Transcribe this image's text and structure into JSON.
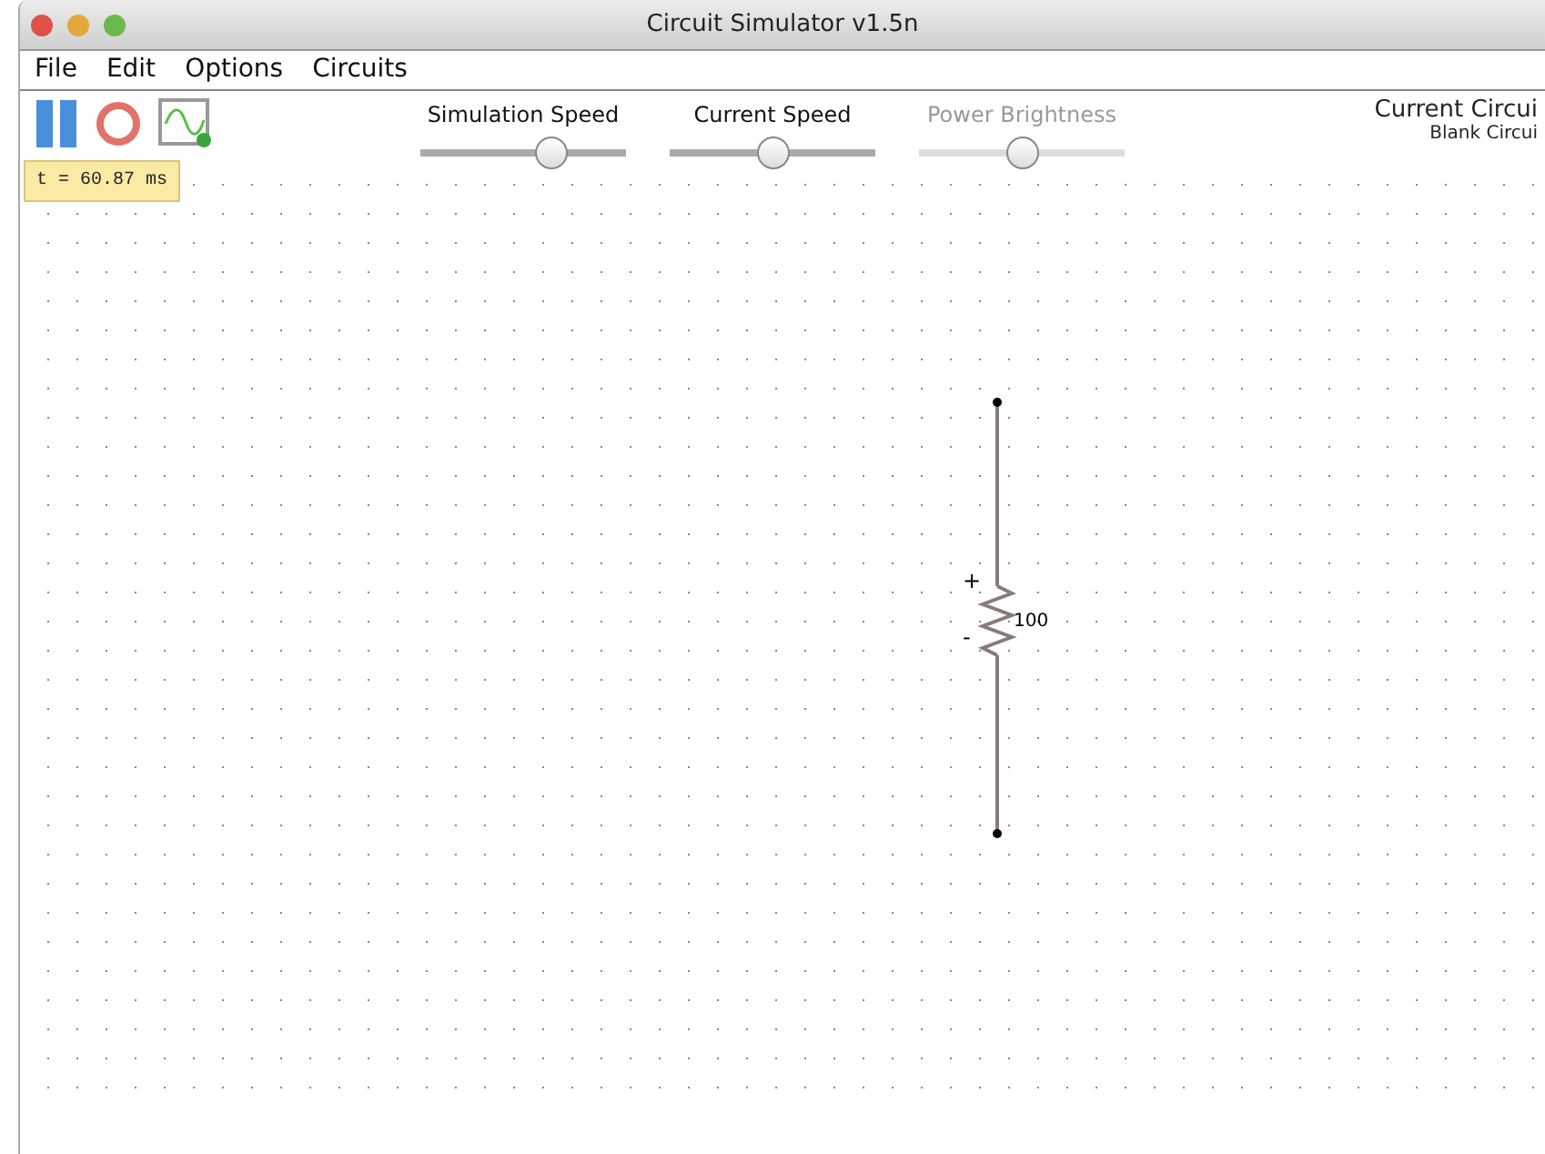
{
  "window": {
    "title": "Circuit Simulator v1.5n"
  },
  "menu": [
    "File",
    "Edit",
    "Options",
    "Circuits"
  ],
  "toolbar": {
    "paused": false,
    "time": "t = 60.87 ms"
  },
  "sliders": [
    {
      "label": "Simulation Speed",
      "level": 0.66,
      "disabled": false
    },
    {
      "label": "Current Speed",
      "level": 0.5,
      "disabled": false
    },
    {
      "label": "Power Brightness",
      "level": 0.5,
      "disabled": true
    }
  ],
  "current_circuit": {
    "heading": "Current Circui",
    "name": "Blank Circui"
  },
  "resistor": {
    "value": "100",
    "plus": "+",
    "minus": "-"
  }
}
